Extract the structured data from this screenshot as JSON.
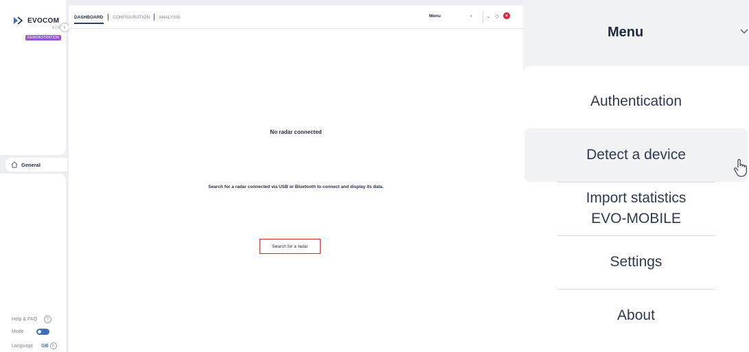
{
  "app": {
    "logo_text": "EVOCOM",
    "version": "4.7.0",
    "badge": "DEMONSTRATION",
    "collapse_glyph": "‹",
    "nav": {
      "general": "General"
    },
    "footer": {
      "help": "Help & FAQ",
      "help_glyph": "?",
      "mode": "Mode",
      "language": "Language",
      "language_code": "GB",
      "language_glyph": "↻"
    },
    "tabs": [
      "DASHBOARD",
      "CONFIGURATION",
      "ANALYSIS"
    ],
    "topbar": {
      "menu_label": "Menu",
      "menu_caret": "▾",
      "icons": {
        "chevron": "⌄",
        "diamond": "◇",
        "close": "×"
      }
    },
    "main": {
      "title": "No radar connected",
      "description": "Search for a radar connected via USB or Bluetooth to connect and display its data.",
      "search_button": "Search for a radar"
    },
    "colors": {
      "accent": "#3b6fb7",
      "badge": "#9a56d0",
      "highlight_border": "#d32a2a",
      "close": "#d7263d"
    }
  },
  "zoom_menu": {
    "title": "Menu",
    "items": [
      {
        "line1": "Authentication",
        "line2": ""
      },
      {
        "line1": "Detect a device",
        "line2": ""
      },
      {
        "line1": "Import statistics",
        "line2": "EVO-MOBILE"
      },
      {
        "line1": "Settings",
        "line2": ""
      },
      {
        "line1": "About",
        "line2": ""
      }
    ],
    "highlighted_index": 1
  }
}
